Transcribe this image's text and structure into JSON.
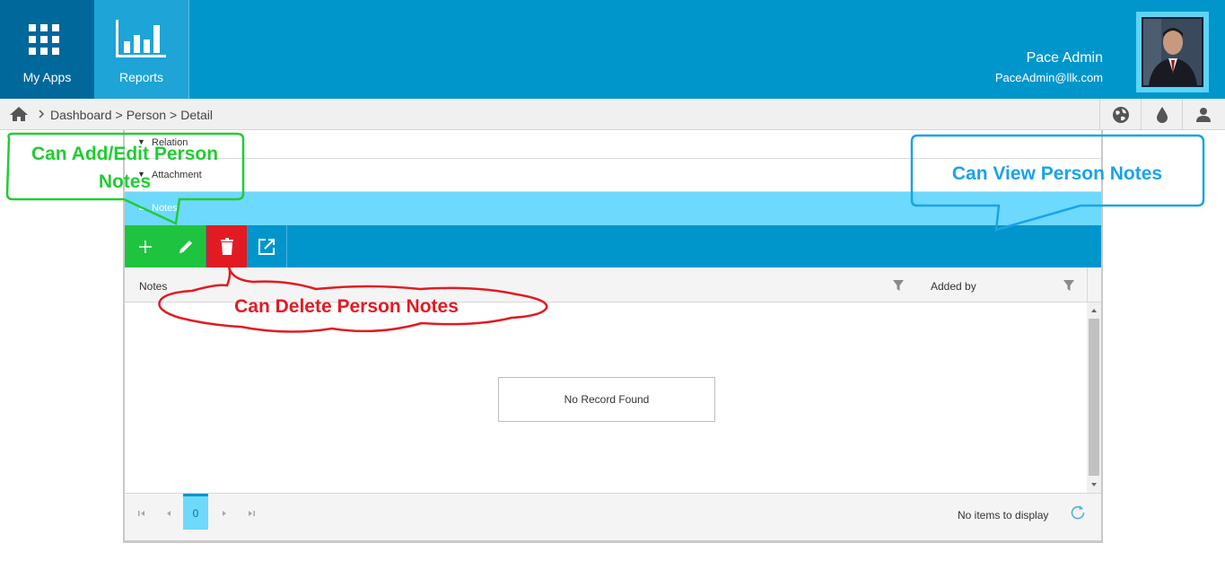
{
  "topbar": {
    "tiles": [
      {
        "label": "My Apps",
        "icon": "grid-icon"
      },
      {
        "label": "Reports",
        "icon": "bar-chart-icon"
      }
    ],
    "user": {
      "name": "Pace Admin",
      "email": "PaceAdmin@llk.com"
    }
  },
  "breadcrumb": {
    "items": [
      "Dashboard",
      ">",
      "Person",
      ">",
      "Detail"
    ]
  },
  "toolbar_icons": [
    "globe-icon",
    "drop-icon",
    "user-icon"
  ],
  "accordion": {
    "sections": [
      {
        "label": "Relation",
        "expanded": false
      },
      {
        "label": "Attachment",
        "expanded": false
      },
      {
        "label": "Notes",
        "expanded": true
      }
    ]
  },
  "grid": {
    "actions": [
      {
        "name": "add",
        "icon": "plus-icon",
        "color": "#1ec43f"
      },
      {
        "name": "edit",
        "icon": "pencil-icon",
        "color": "#1ec43f"
      },
      {
        "name": "delete",
        "icon": "trash-icon",
        "color": "#e21b23"
      },
      {
        "name": "open",
        "icon": "external-link-icon",
        "color": "#0096cc"
      }
    ],
    "columns": [
      "Notes",
      "Added by"
    ],
    "empty_message": "No Record Found",
    "pager": {
      "page": "0",
      "status": "No items to display"
    }
  },
  "annotations": {
    "add_edit": "Can Add/Edit Person Notes",
    "view": "Can View Person Notes",
    "delete": "Can Delete Person Notes"
  },
  "colors": {
    "header": "#0096cc",
    "header_dark": "#00689a",
    "notes_section": "#6dd9fd",
    "add_edit_green": "#1ec43f",
    "delete_red": "#e21b23",
    "callout_blue": "#1aa3e8"
  }
}
